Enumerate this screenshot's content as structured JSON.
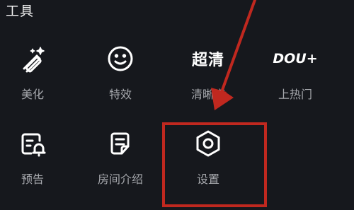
{
  "section": {
    "title": "工具"
  },
  "tools": [
    {
      "label": "美化",
      "icon": "magic-wand-icon"
    },
    {
      "label": "特效",
      "icon": "smiley-icon"
    },
    {
      "label": "清晰度",
      "icon_text": "超清"
    },
    {
      "label": "上热门",
      "icon_text": "DOU+"
    },
    {
      "label": "预告",
      "icon": "calendar-bell-icon"
    },
    {
      "label": "房间介绍",
      "icon": "note-edit-icon"
    },
    {
      "label": "设置",
      "icon": "hexagon-settings-icon"
    }
  ],
  "colors": {
    "background": "#16181d",
    "label": "#a6a8ad",
    "annotation_red": "#c0281f"
  }
}
